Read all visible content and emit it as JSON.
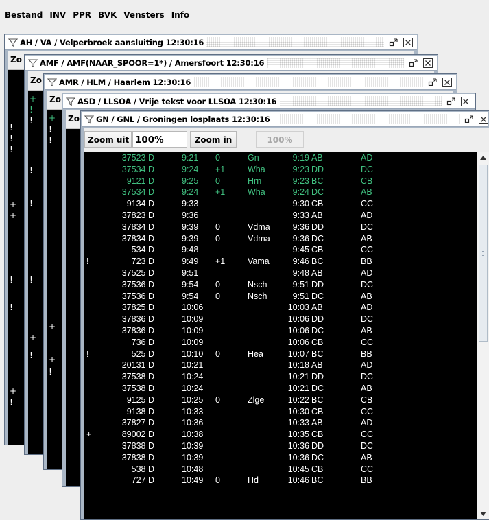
{
  "menubar": {
    "items": [
      {
        "label": "Bestand"
      },
      {
        "label": "INV"
      },
      {
        "label": "PPR"
      },
      {
        "label": "BVK"
      },
      {
        "label": "Vensters"
      },
      {
        "label": "Info"
      }
    ]
  },
  "windows": [
    {
      "title": "AH / VA / Velperbroek aansluiting 12:30:16",
      "zoom_label": "Zo"
    },
    {
      "title": "AMF / AMF(NAAR_SPOOR=1*) / Amersfoort 12:30:16",
      "zoom_label": "Zo"
    },
    {
      "title": "AMR / HLM / Haarlem 12:30:16",
      "zoom_label": "Zo"
    },
    {
      "title": "ASD / LLSOA / Vrije tekst voor LLSOA 12:30:16",
      "zoom_label": "Zo"
    },
    {
      "title": "GN / GNL / Groningen losplaats 12:30:16",
      "zoom_label": "Zo"
    }
  ],
  "front_toolbar": {
    "zoom_out_label": "Zoom uit",
    "zoom_value": "100%",
    "zoom_in_label": "Zoom in",
    "zoom_reset_label": "100%"
  },
  "icons": {
    "filter": "filter-icon",
    "restore": "restore-icon",
    "close": "close-icon",
    "scroll_up": "scroll-up-arrow-icon",
    "scroll_down": "scroll-down-arrow-icon"
  },
  "colors": {
    "text_default": "#ffffff",
    "text_highlight": "#40c080",
    "background": "#000000",
    "frame_border": "#a9b6c5"
  },
  "table_rows": [
    {
      "train": "37523 D",
      "time": "9:21",
      "delay": "0",
      "station": "Gn",
      "plan": "9:19",
      "track": "AB",
      "dir": "AD",
      "green": true
    },
    {
      "train": "37534 D",
      "time": "9:24",
      "delay": "+1",
      "station": "Wha",
      "plan": "9:23",
      "track": "DD",
      "dir": "DC",
      "green": true
    },
    {
      "train": "9121 D",
      "time": "9:25",
      "delay": "0",
      "station": "Hrn",
      "plan": "9:23",
      "track": "BC",
      "dir": "CB",
      "green": true
    },
    {
      "train": "37534 D",
      "time": "9:24",
      "delay": "+1",
      "station": "Wha",
      "plan": "9:24",
      "track": "DC",
      "dir": "AB",
      "green": true
    },
    {
      "train": "9134 D",
      "time": "9:33",
      "delay": "",
      "station": "",
      "plan": "9:30",
      "track": "CB",
      "dir": "CC"
    },
    {
      "train": "37823 D",
      "time": "9:36",
      "delay": "",
      "station": "",
      "plan": "9:33",
      "track": "AB",
      "dir": "AD"
    },
    {
      "train": "37834 D",
      "time": "9:39",
      "delay": "0",
      "station": "Vdma",
      "plan": "9:36",
      "track": "DD",
      "dir": "DC"
    },
    {
      "train": "37834 D",
      "time": "9:39",
      "delay": "0",
      "station": "Vdma",
      "plan": "9:36",
      "track": "DC",
      "dir": "AB"
    },
    {
      "train": "534 D",
      "time": "9:48",
      "delay": "",
      "station": "",
      "plan": "9:45",
      "track": "CB",
      "dir": "CC"
    },
    {
      "train": "723 D",
      "time": "9:49",
      "delay": "+1",
      "station": "Vama",
      "plan": "9:46",
      "track": "BC",
      "dir": "BB",
      "mark": "!"
    },
    {
      "train": "37525 D",
      "time": "9:51",
      "delay": "",
      "station": "",
      "plan": "9:48",
      "track": "AB",
      "dir": "AD"
    },
    {
      "train": "37536 D",
      "time": "9:54",
      "delay": "0",
      "station": "Nsch",
      "plan": "9:51",
      "track": "DD",
      "dir": "DC"
    },
    {
      "train": "37536 D",
      "time": "9:54",
      "delay": "0",
      "station": "Nsch",
      "plan": "9:51",
      "track": "DC",
      "dir": "AB"
    },
    {
      "train": "37825 D",
      "time": "10:06",
      "delay": "",
      "station": "",
      "plan": "10:03",
      "track": "AB",
      "dir": "AD"
    },
    {
      "train": "37836 D",
      "time": "10:09",
      "delay": "",
      "station": "",
      "plan": "10:06",
      "track": "DD",
      "dir": "DC"
    },
    {
      "train": "37836 D",
      "time": "10:09",
      "delay": "",
      "station": "",
      "plan": "10:06",
      "track": "DC",
      "dir": "AB"
    },
    {
      "train": "736 D",
      "time": "10:09",
      "delay": "",
      "station": "",
      "plan": "10:06",
      "track": "CB",
      "dir": "CC"
    },
    {
      "train": "525 D",
      "time": "10:10",
      "delay": "0",
      "station": "Hea",
      "plan": "10:07",
      "track": "BC",
      "dir": "BB",
      "mark": "!"
    },
    {
      "train": "20131 D",
      "time": "10:21",
      "delay": "",
      "station": "",
      "plan": "10:18",
      "track": "AB",
      "dir": "AD"
    },
    {
      "train": "37538 D",
      "time": "10:24",
      "delay": "",
      "station": "",
      "plan": "10:21",
      "track": "DD",
      "dir": "DC"
    },
    {
      "train": "37538 D",
      "time": "10:24",
      "delay": "",
      "station": "",
      "plan": "10:21",
      "track": "DC",
      "dir": "AB"
    },
    {
      "train": "9125 D",
      "time": "10:25",
      "delay": "0",
      "station": "Zlge",
      "plan": "10:22",
      "track": "BC",
      "dir": "CB"
    },
    {
      "train": "9138 D",
      "time": "10:33",
      "delay": "",
      "station": "",
      "plan": "10:30",
      "track": "CB",
      "dir": "CC"
    },
    {
      "train": "37827 D",
      "time": "10:36",
      "delay": "",
      "station": "",
      "plan": "10:33",
      "track": "AB",
      "dir": "AD"
    },
    {
      "train": "89002 D",
      "time": "10:38",
      "delay": "",
      "station": "",
      "plan": "10:35",
      "track": "CB",
      "dir": "CC",
      "mark": "+"
    },
    {
      "train": "37838 D",
      "time": "10:39",
      "delay": "",
      "station": "",
      "plan": "10:36",
      "track": "DD",
      "dir": "DC"
    },
    {
      "train": "37838 D",
      "time": "10:39",
      "delay": "",
      "station": "",
      "plan": "10:36",
      "track": "DC",
      "dir": "AB"
    },
    {
      "train": "538 D",
      "time": "10:48",
      "delay": "",
      "station": "",
      "plan": "10:45",
      "track": "CB",
      "dir": "CC"
    },
    {
      "train": "727 D",
      "time": "10:49",
      "delay": "0",
      "station": "Hd",
      "plan": "10:46",
      "track": "BC",
      "dir": "BB"
    }
  ],
  "side_marks": [
    {
      "window": 0,
      "marks": [
        "!",
        "!",
        "!",
        "+",
        "+",
        "!",
        "!",
        "+",
        "!"
      ]
    },
    {
      "window": 1,
      "marks": [
        "+",
        "!",
        "!",
        "!",
        "!",
        "!",
        "+",
        "!"
      ]
    },
    {
      "window": 2,
      "marks": [
        "+",
        "!",
        "!",
        "+",
        "+",
        "!"
      ]
    },
    {
      "window": 3,
      "marks": []
    }
  ]
}
